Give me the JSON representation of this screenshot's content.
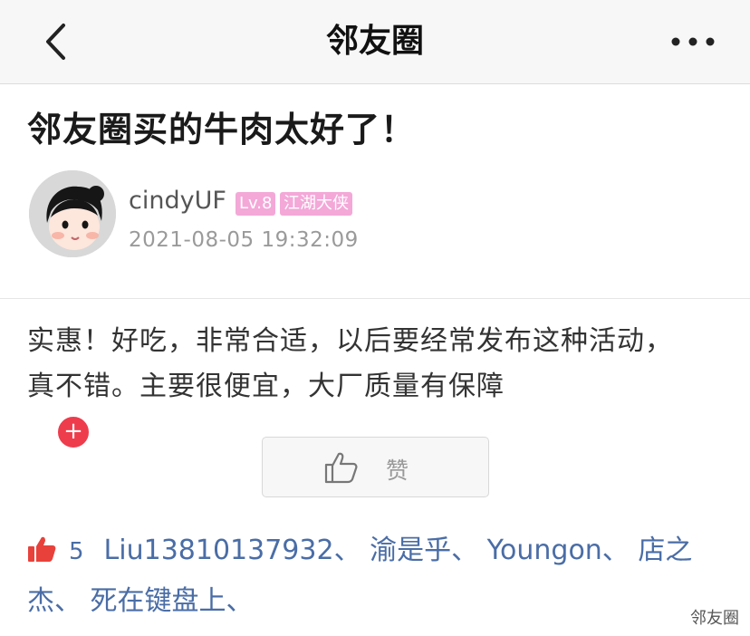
{
  "nav": {
    "title": "邻友圈",
    "back_icon": "chevron-left-icon",
    "more_icon": "more-dots-icon"
  },
  "post": {
    "title": "邻友圈买的牛肉太好了！",
    "author": {
      "name": "cindyUF",
      "level": "Lv.8",
      "rank": "江湖大侠",
      "follow_icon": "plus-icon"
    },
    "time": "2021-08-05 19:32:09",
    "content_lines": [
      "实惠！好吃，非常合适，以后要经常发布这种活动，",
      "真不错。主要很便宜，大厂质量有保障"
    ]
  },
  "like_button": {
    "label": "赞",
    "icon": "thumb-up-icon"
  },
  "likes": {
    "count": "5",
    "icon": "thumb-up-icon",
    "users": [
      "Liu13810137932、",
      "渝是乎、",
      "Youngon、",
      "店之杰、",
      "死在键盘上、"
    ]
  },
  "watermark": "邻友圈",
  "colors": {
    "link": "#4a6da6",
    "badge": "#f3a8d8",
    "follow": "#ee3c4d",
    "like_icon": "#e8413b"
  }
}
